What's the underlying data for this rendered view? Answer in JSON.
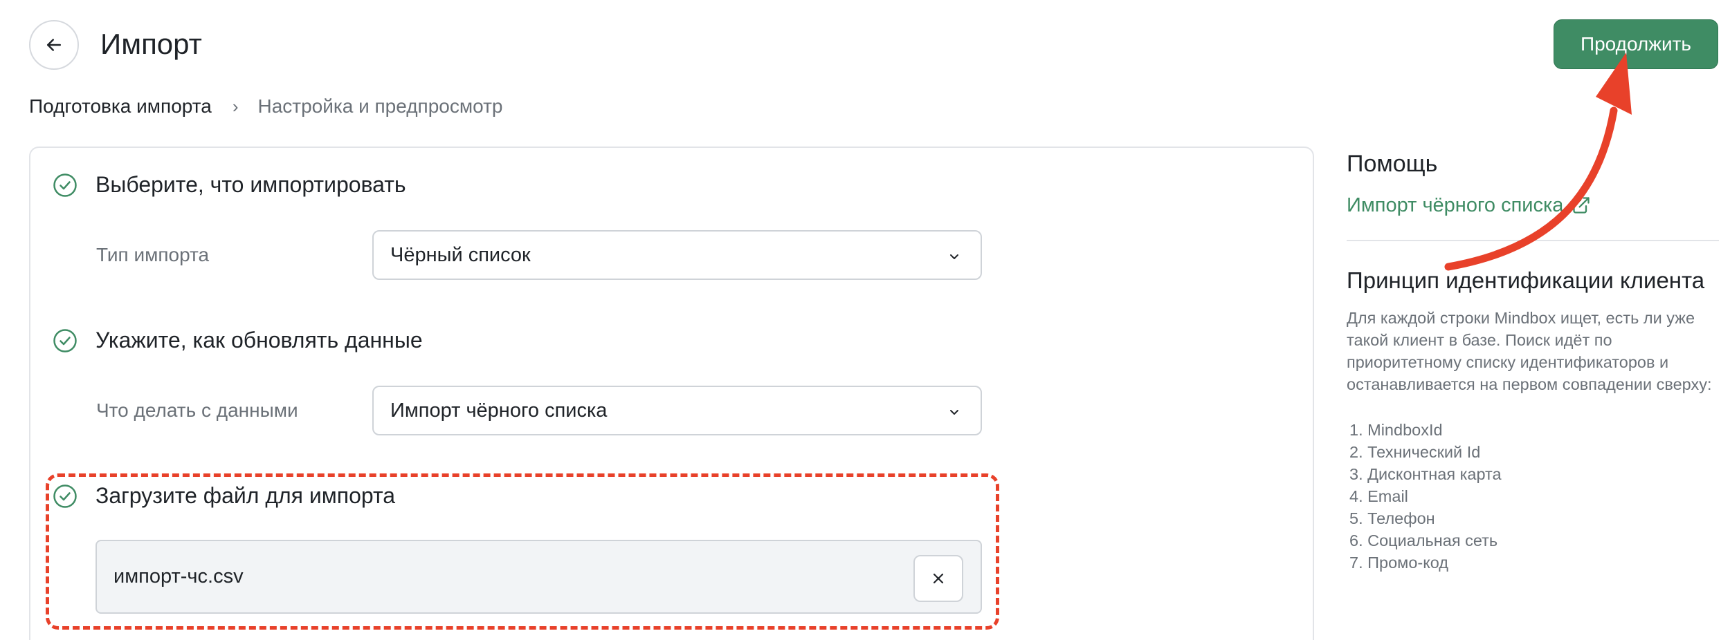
{
  "header": {
    "title": "Импорт",
    "continue_label": "Продолжить"
  },
  "breadcrumb": {
    "step1": "Подготовка импорта",
    "separator": "›",
    "step2": "Настройка и предпросмотр"
  },
  "sections": {
    "choose": {
      "title": "Выберите, что импортировать",
      "field_label": "Тип импорта",
      "value": "Чёрный список"
    },
    "update": {
      "title": "Укажите, как обновлять данные",
      "field_label": "Что делать с данными",
      "value": "Импорт чёрного списка"
    },
    "upload": {
      "title": "Загрузите файл для импорта",
      "file_name": "импорт-чс.csv"
    }
  },
  "help": {
    "title": "Помощь",
    "link_label": "Импорт чёрного списка",
    "principle_title": "Принцип идентификации клиента",
    "principle_desc": "Для каждой строки Mindbox ищет, есть ли уже такой клиент в базе. Поиск идёт по приоритетному списку идентификаторов и останавливается на первом совпадении сверху:",
    "identifiers": [
      "1. MindboxId",
      "2. Технический Id",
      "3. Дисконтная карта",
      "4. Email",
      "5. Телефон",
      "6. Социальная сеть",
      "7. Промо-код"
    ]
  },
  "colors": {
    "accent": "#3f8c64",
    "annotation": "#e8412a",
    "muted_text": "#6b7178",
    "border": "#cfd3d8"
  },
  "icons": {
    "back": "arrow-left-icon",
    "check": "check-circle-icon",
    "chevron": "chevron-down-icon",
    "remove": "close-icon",
    "external": "external-link-icon"
  }
}
